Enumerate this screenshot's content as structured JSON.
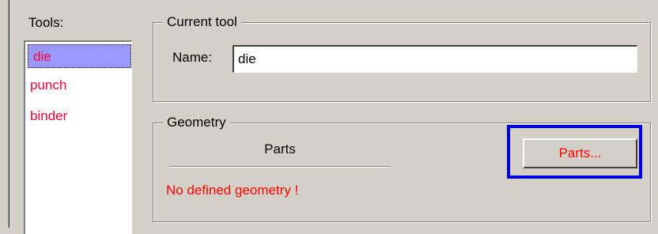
{
  "tools_panel": {
    "label": "Tools:",
    "items": [
      {
        "label": "die",
        "selected": true
      },
      {
        "label": "punch",
        "selected": false
      },
      {
        "label": "binder",
        "selected": false
      }
    ]
  },
  "current_tool": {
    "legend": "Current tool",
    "name_label": "Name:",
    "name_value": "die"
  },
  "geometry": {
    "legend": "Geometry",
    "parts_header": "Parts",
    "status_text": "No defined geometry !",
    "parts_button_label": "Parts..."
  },
  "colors": {
    "background": "#d4d0c8",
    "tool_text": "#ff0033",
    "selection": "#9999ff",
    "warning_text": "#ff0000",
    "highlight": "#0000dd"
  }
}
